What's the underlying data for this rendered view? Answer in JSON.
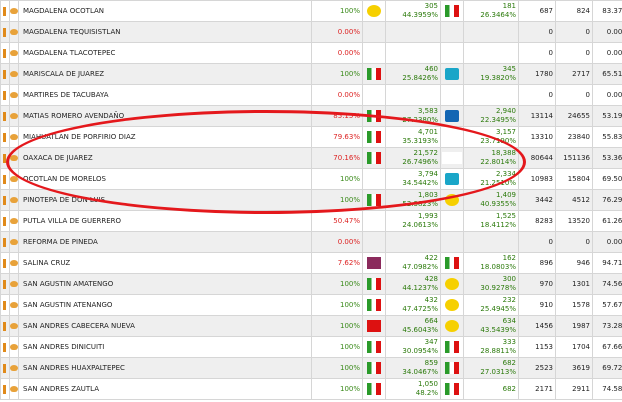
{
  "rows": [
    {
      "name": "MAGDALENA OCOTLAN",
      "pct": "100%",
      "pct_red": false,
      "l1": "prd",
      "v1": "305",
      "p1": "44.3959%",
      "l2": "pri",
      "v2": "181",
      "p2": "26.3464%",
      "n1": "687",
      "n2": "824",
      "fin": "83.37%",
      "alt": false
    },
    {
      "name": "MAGDALENA TEQUISISTLAN",
      "pct": "0.00%",
      "pct_red": true,
      "l1": "",
      "v1": "",
      "p1": "",
      "l2": "",
      "v2": "",
      "p2": "",
      "n1": "0",
      "n2": "0",
      "fin": "0.00%",
      "alt": true
    },
    {
      "name": "MAGDALENA TLACOTEPEC",
      "pct": "0.00%",
      "pct_red": true,
      "l1": "",
      "v1": "",
      "p1": "",
      "l2": "",
      "v2": "",
      "p2": "",
      "n1": "0",
      "n2": "0",
      "fin": "0.00%",
      "alt": false
    },
    {
      "name": "MARISCALA DE JUAREZ",
      "pct": "100%",
      "pct_red": false,
      "l1": "pri",
      "v1": "460",
      "p1": "25.8426%",
      "l2": "alianza",
      "v2": "345",
      "p2": "19.3820%",
      "n1": "1780",
      "n2": "2717",
      "fin": "65.51%",
      "alt": true
    },
    {
      "name": "MARTIRES DE TACUBAYA",
      "pct": "0.00%",
      "pct_red": true,
      "l1": "",
      "v1": "",
      "p1": "",
      "l2": "",
      "v2": "",
      "p2": "",
      "n1": "0",
      "n2": "0",
      "fin": "0.00%",
      "alt": false
    },
    {
      "name": "MATIAS ROMERO AVENDAÑO",
      "pct": "85.15%",
      "pct_red": true,
      "l1": "pri",
      "v1": "3,583",
      "p1": "27.2380%",
      "l2": "panal",
      "v2": "2,940",
      "p2": "22.3495%",
      "n1": "13114",
      "n2": "24655",
      "fin": "53.19%",
      "alt": true
    },
    {
      "name": "MIAHUATLAN DE PORFIRIO DIAZ",
      "pct": "79.63%",
      "pct_red": true,
      "l1": "pri",
      "v1": "4,701",
      "p1": "35.3193%",
      "l2": "morena",
      "v2": "3,157",
      "p2": "23.7190%",
      "n1": "13310",
      "n2": "23840",
      "fin": "55.83%",
      "alt": false
    },
    {
      "name": "OAXACA DE JUAREZ",
      "pct": "70.16%",
      "pct_red": true,
      "l1": "pri",
      "v1": "21,572",
      "p1": "26.7496%",
      "l2": "morena",
      "v2": "18,388",
      "p2": "22.8014%",
      "n1": "80644",
      "n2": "151136",
      "fin": "53.36%",
      "alt": true
    },
    {
      "name": "OCOTLAN DE MORELOS",
      "pct": "100%",
      "pct_red": false,
      "l1": "morena",
      "v1": "3,794",
      "p1": "34.5442%",
      "l2": "alianza",
      "v2": "2,334",
      "p2": "21.2510%",
      "n1": "10983",
      "n2": "15804",
      "fin": "69.50%",
      "alt": false
    },
    {
      "name": "PINOTEPA DE DON LUIS",
      "pct": "100%",
      "pct_red": false,
      "l1": "pri",
      "v1": "1,803",
      "p1": "52.3823%",
      "l2": "prd",
      "v2": "1,409",
      "p2": "40.9355%",
      "n1": "3442",
      "n2": "4512",
      "fin": "76.29%",
      "alt": true
    },
    {
      "name": "PUTLA VILLA DE GUERRERO",
      "pct": "50.47%",
      "pct_red": true,
      "l1": "morena",
      "v1": "1,993",
      "p1": "24.0613%",
      "l2": "morena",
      "v2": "1,525",
      "p2": "18.4112%",
      "n1": "8283",
      "n2": "13520",
      "fin": "61.26%",
      "alt": false
    },
    {
      "name": "REFORMA DE PINEDA",
      "pct": "0.00%",
      "pct_red": true,
      "l1": "",
      "v1": "",
      "p1": "",
      "l2": "",
      "v2": "",
      "p2": "",
      "n1": "0",
      "n2": "0",
      "fin": "0.00%",
      "alt": true
    },
    {
      "name": "SALINA CRUZ",
      "pct": "7.62%",
      "pct_red": true,
      "l1": "mor2",
      "v1": "422",
      "p1": "47.0982%",
      "l2": "pri",
      "v2": "162",
      "p2": "18.0803%",
      "n1": "896",
      "n2": "946",
      "fin": "94.71%",
      "alt": false
    },
    {
      "name": "SAN AGUSTIN AMATENGO",
      "pct": "100%",
      "pct_red": false,
      "l1": "pri",
      "v1": "428",
      "p1": "44.1237%",
      "l2": "prd",
      "v2": "300",
      "p2": "30.9278%",
      "n1": "970",
      "n2": "1301",
      "fin": "74.56%",
      "alt": true
    },
    {
      "name": "SAN AGUSTIN ATENANGO",
      "pct": "100%",
      "pct_red": false,
      "l1": "pri",
      "v1": "432",
      "p1": "47.4725%",
      "l2": "prd",
      "v2": "232",
      "p2": "25.4945%",
      "n1": "910",
      "n2": "1578",
      "fin": "57.67%",
      "alt": false
    },
    {
      "name": "SAN ANDRES CABECERA NUEVA",
      "pct": "100%",
      "pct_red": false,
      "l1": "pt",
      "v1": "664",
      "p1": "45.6043%",
      "l2": "prd",
      "v2": "634",
      "p2": "43.5439%",
      "n1": "1456",
      "n2": "1987",
      "fin": "73.28%",
      "alt": true
    },
    {
      "name": "SAN ANDRES DINICUITI",
      "pct": "100%",
      "pct_red": false,
      "l1": "pri",
      "v1": "347",
      "p1": "30.0954%",
      "l2": "pri",
      "v2": "333",
      "p2": "28.8811%",
      "n1": "1153",
      "n2": "1704",
      "fin": "67.66%",
      "alt": false
    },
    {
      "name": "SAN ANDRES HUAXPALTEPEC",
      "pct": "100%",
      "pct_red": false,
      "l1": "pri",
      "v1": "859",
      "p1": "34.0467%",
      "l2": "pri",
      "v2": "682",
      "p2": "27.0313%",
      "n1": "2523",
      "n2": "3619",
      "fin": "69.72%",
      "alt": true
    },
    {
      "name": "SAN ANDRES ZAUTLA",
      "pct": "100%",
      "pct_red": false,
      "l1": "pri",
      "v1": "1,050",
      "p1": "48.2%",
      "l2": "pri",
      "v2": "682",
      "p2": "",
      "n1": "2171",
      "n2": "2911",
      "fin": "74.58%",
      "alt": false
    }
  ]
}
